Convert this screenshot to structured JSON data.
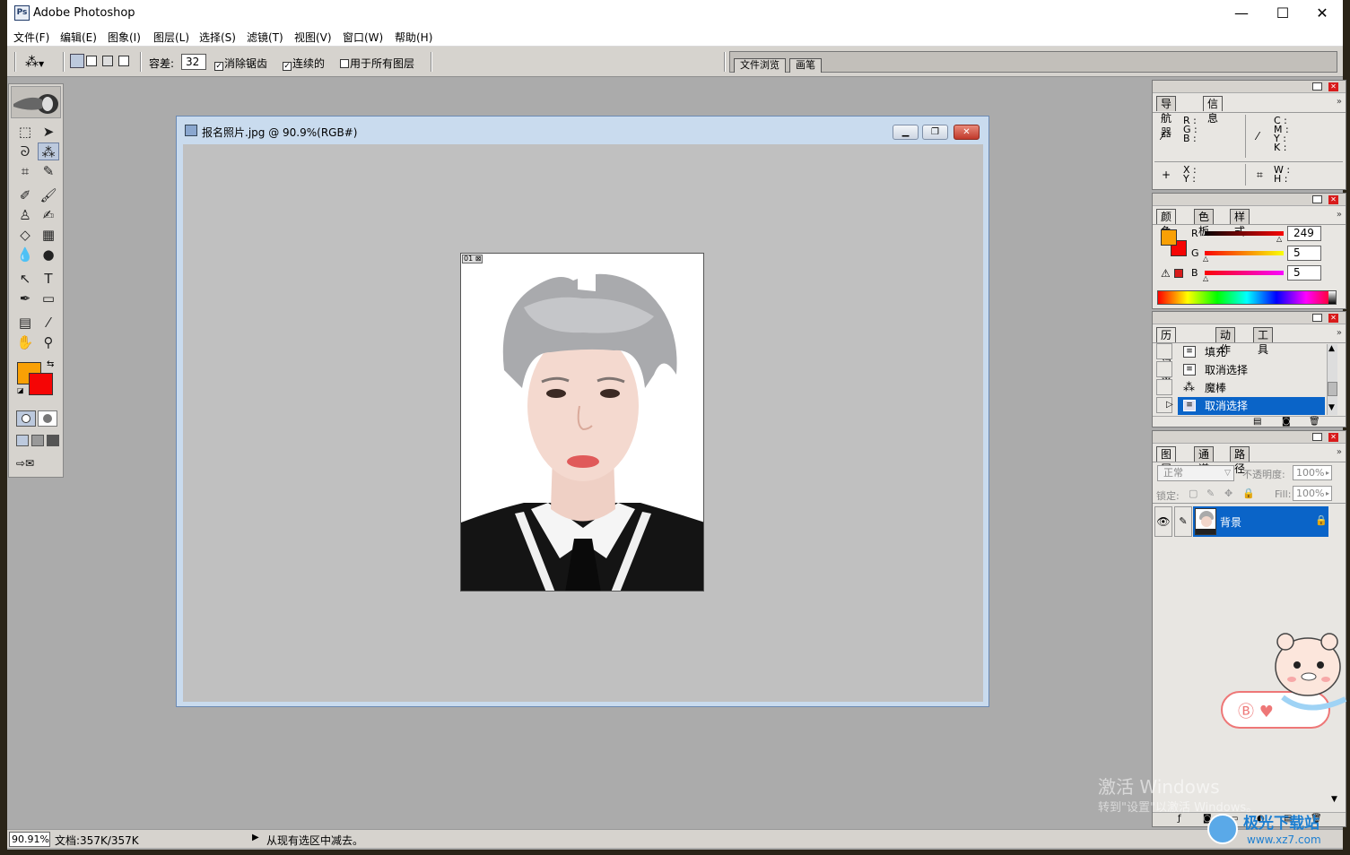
{
  "window": {
    "title": "Adobe Photoshop",
    "icon_text": "Ps",
    "controls": [
      "—",
      "☐",
      "✕"
    ]
  },
  "menu": [
    "文件(F)",
    "编辑(E)",
    "图象(I)",
    "图层(L)",
    "选择(S)",
    "滤镜(T)",
    "视图(V)",
    "窗口(W)",
    "帮助(H)"
  ],
  "options_bar": {
    "tolerance_label": "容差:",
    "tolerance_value": "32",
    "antialias_label": "消除锯齿",
    "contiguous_label": "连续的",
    "all_layers_label": "用于所有图层",
    "well_tabs": [
      "文件浏览",
      "画笔"
    ]
  },
  "toolbox": {
    "fg_color": "#f9a005",
    "bg_color": "#f50505"
  },
  "document": {
    "title": "报名照片.jpg @ 90.9%(RGB#)",
    "image_tag": "01"
  },
  "panels": {
    "navigator": {
      "tabs": [
        "导航器",
        "信息"
      ],
      "rgb_labels": [
        "R",
        "G",
        "B"
      ],
      "cmyk_labels": [
        "C",
        "M",
        "Y",
        "K"
      ],
      "xy_labels": [
        "X",
        "Y"
      ],
      "wh_labels": [
        "W",
        "H"
      ]
    },
    "color": {
      "tabs": [
        "颜色",
        "色板",
        "样式"
      ],
      "channels": [
        {
          "label": "R",
          "value": "249"
        },
        {
          "label": "G",
          "value": "5"
        },
        {
          "label": "B",
          "value": "5"
        }
      ],
      "fg_color": "#f9a005",
      "bg_color": "#f50505"
    },
    "history": {
      "tabs": [
        "历史记录",
        "动作",
        "工具"
      ],
      "items": [
        {
          "label": "填充",
          "selected": false
        },
        {
          "label": "取消选择",
          "selected": false
        },
        {
          "label": "魔棒",
          "selected": false
        },
        {
          "label": "取消选择",
          "selected": true
        }
      ]
    },
    "layers": {
      "tabs": [
        "图层",
        "通道",
        "路径"
      ],
      "blend_mode": "正常",
      "opacity_label": "不透明度:",
      "opacity_value": "100%",
      "lock_label": "锁定:",
      "fill_label": "Fill:",
      "fill_value": "100%",
      "layer_name": "背景"
    }
  },
  "status": {
    "zoom": "90.91%",
    "doc_info": "文档:357K/357K",
    "message": "从现有选区中减去。"
  },
  "overlay": {
    "activate_line1": "激活 Windows",
    "activate_line2": "转到\"设置\"以激活 Windows。",
    "site_name": "极光下载站",
    "site_url": "www.xz7.com"
  },
  "colors": {
    "selection_blue": "#0a64c8",
    "canvas_gray": "#c0c0c0",
    "workspace_gray": "#ababab"
  }
}
